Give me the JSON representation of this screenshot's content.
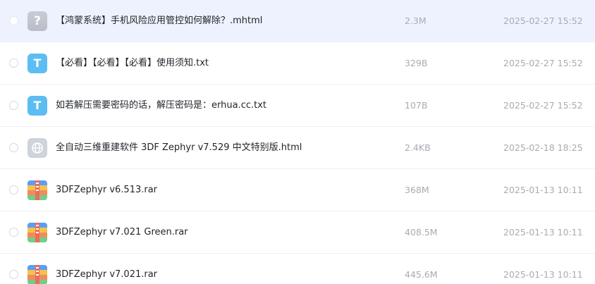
{
  "files": [
    {
      "name": "【鸿蒙系统】手机风险应用管控如何解除？.mhtml",
      "size": "2.3M",
      "date": "2025-02-27 15:52",
      "icon": "unknown-file-icon",
      "icon_glyph": "?",
      "selected": true
    },
    {
      "name": "【必看】【必看】【必看】使用须知.txt",
      "size": "329B",
      "date": "2025-02-27 15:52",
      "icon": "text-file-icon",
      "icon_glyph": "T",
      "selected": false
    },
    {
      "name": "如若解压需要密码的话，解压密码是：erhua.cc.txt",
      "size": "107B",
      "date": "2025-02-27 15:52",
      "icon": "text-file-icon",
      "icon_glyph": "T",
      "selected": false
    },
    {
      "name": "全自动三维重建软件 3DF Zephyr v7.529 中文特别版.html",
      "size": "2.4KB",
      "date": "2025-02-18 18:25",
      "icon": "web-file-icon",
      "icon_glyph": "",
      "selected": false
    },
    {
      "name": "3DFZephyr v6.513.rar",
      "size": "368M",
      "date": "2025-01-13 10:11",
      "icon": "archive-file-icon",
      "icon_glyph": "",
      "selected": false
    },
    {
      "name": "3DFZephyr v7.021 Green.rar",
      "size": "408.5M",
      "date": "2025-01-13 10:11",
      "icon": "archive-file-icon",
      "icon_glyph": "",
      "selected": false
    },
    {
      "name": "3DFZephyr v7.021.rar",
      "size": "445.6M",
      "date": "2025-01-13 10:11",
      "icon": "archive-file-icon",
      "icon_glyph": "",
      "selected": false
    }
  ],
  "colors": {
    "selected_row_bg": "#eef2fe",
    "text_icon_bg": "#5cbdf2",
    "archive_bands": [
      "#5b9ef5",
      "#f5c24c",
      "#f08c5a",
      "#6fcf8a"
    ]
  }
}
